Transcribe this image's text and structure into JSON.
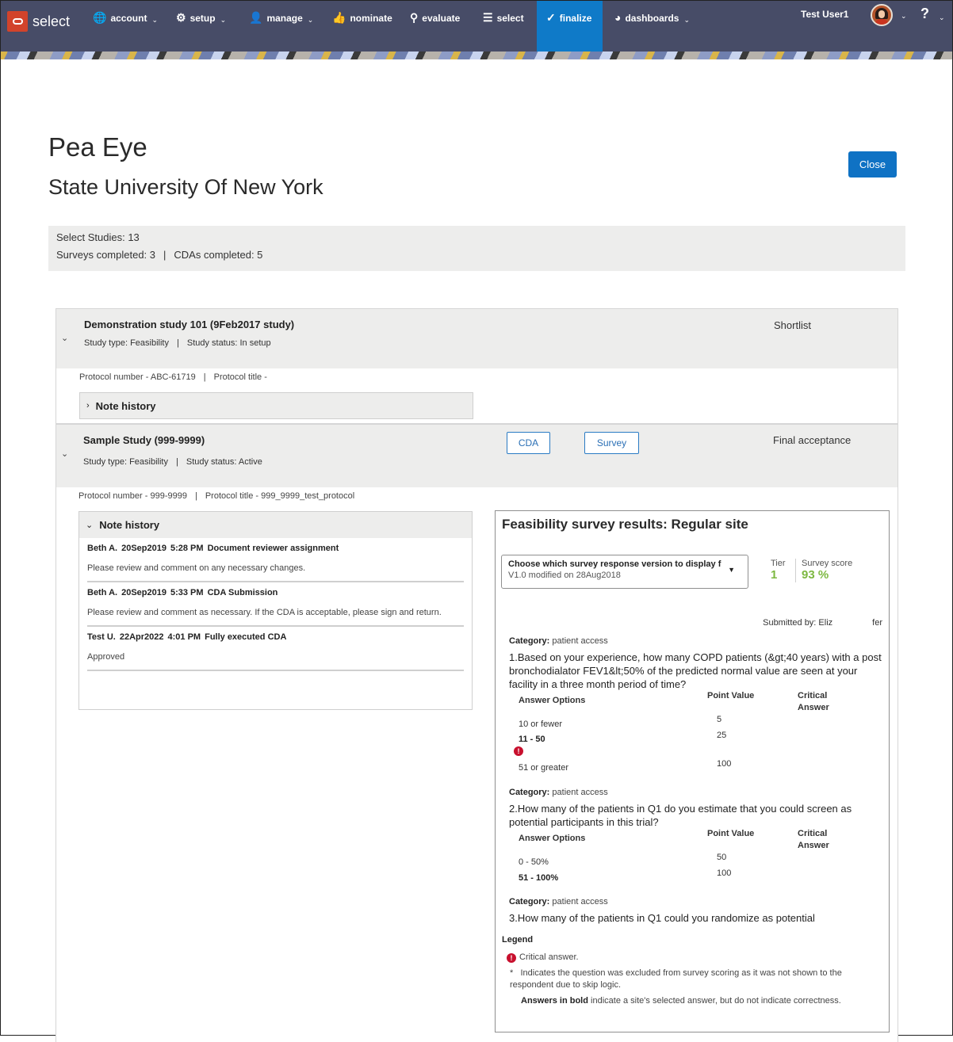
{
  "nav": {
    "brand": "select",
    "items": [
      {
        "label": "account",
        "icon": "globe-icon",
        "has_menu": true
      },
      {
        "label": "setup",
        "icon": "gear-icon",
        "has_menu": true
      },
      {
        "label": "manage",
        "icon": "user-icon",
        "has_menu": true
      },
      {
        "label": "nominate",
        "icon": "thumbs-up-icon",
        "has_menu": false
      },
      {
        "label": "evaluate",
        "icon": "search-icon",
        "has_menu": false
      },
      {
        "label": "select",
        "icon": "list-icon",
        "has_menu": false
      },
      {
        "label": "finalize",
        "icon": "check-circle-icon",
        "has_menu": false,
        "active": true
      },
      {
        "label": "dashboards",
        "icon": "pie-chart-icon",
        "has_menu": true
      }
    ],
    "user_name": "Test User1",
    "help_label": "?",
    "active_color": "#0f7ac8",
    "bar_color": "#474c67"
  },
  "page": {
    "title": "Pea Eye",
    "subtitle": "State University Of New York",
    "close_label": "Close",
    "summary": {
      "select_studies": "Select Studies: 13",
      "surveys_completed": "Surveys completed: 3",
      "separator": "|",
      "cdas_completed": "CDAs completed: 5"
    }
  },
  "studies": [
    {
      "name": "Demonstration study 101 (9Feb2017 study)",
      "type": "Study type: Feasibility",
      "separator": "|",
      "status": "Study status: In setup",
      "stage": "Shortlist",
      "protocol_number": "Protocol number - ABC-61719",
      "protocol_title": "Protocol title -",
      "note_history_label": "Note history",
      "note_history_expanded": false
    },
    {
      "name": "Sample Study (999-9999)",
      "type": "Study type: Feasibility",
      "separator": "|",
      "status": "Study status: Active",
      "stage": "Final acceptance",
      "cda_label": "CDA",
      "survey_label": "Survey",
      "protocol_number": "Protocol number - 999-9999",
      "protocol_title": "Protocol title - 999_9999_test_protocol",
      "note_history_label": "Note history",
      "note_history_expanded": true,
      "notes": [
        {
          "author": "Beth A.",
          "date": "20Sep2019",
          "time": "5:28 PM",
          "subject": "Document reviewer assignment",
          "body": "Please review and comment on any necessary changes."
        },
        {
          "author": "Beth A.",
          "date": "20Sep2019",
          "time": "5:33 PM",
          "subject": "CDA Submission",
          "body": "Please review and comment as necessary. If the CDA is acceptable, please sign and return."
        },
        {
          "author": "Test U.",
          "date": "22Apr2022",
          "time": "4:01 PM",
          "subject": "Fully executed CDA",
          "body": "Approved"
        }
      ]
    }
  ],
  "survey": {
    "title": "Feasibility survey results: Regular site",
    "version_select_label": "Choose which survey response version to display f",
    "version_select_value": "V1.0 modified on 28Aug2018",
    "tier_label": "Tier",
    "tier_value": "1",
    "score_label": "Survey score",
    "score_value": "93 %",
    "score_color": "#7db841",
    "submitted_by_prefix": "Submitted by: Eliz",
    "submitted_by_suffix": "fer",
    "columns": {
      "options": "Answer Options",
      "points": "Point Value",
      "critical_1": "Critical",
      "critical_2": "Answer"
    },
    "category_label": "Category:",
    "questions": [
      {
        "category": "patient access",
        "text": "1.Based on your experience, how many COPD patients (&gt;40 years) with a post bronchodialator FEV1&lt;50% of the predicted normal value are seen at your facility in a three month period of time?",
        "answers": [
          {
            "option": "10 or fewer",
            "points": "5",
            "selected": false,
            "critical": false
          },
          {
            "option": "11 - 50",
            "points": "25",
            "selected": true,
            "critical": true
          },
          {
            "option": "51 or greater",
            "points": "100",
            "selected": false,
            "critical": false
          }
        ]
      },
      {
        "category": "patient access",
        "text": "2.How many of the patients in Q1 do you estimate that you could screen as potential participants in this trial?",
        "answers": [
          {
            "option": "0 - 50%",
            "points": "50",
            "selected": false,
            "critical": false
          },
          {
            "option": "51 - 100%",
            "points": "100",
            "selected": true,
            "critical": false
          }
        ]
      },
      {
        "category": "patient access",
        "text": "3.How many of the patients in Q1 could you randomize as potential"
      }
    ],
    "legend": {
      "title": "Legend",
      "critical": "Critical answer.",
      "asterisk": "*",
      "excluded": "Indicates the question was excluded from survey scoring as it was not shown to the respondent due to skip logic.",
      "bold_prefix": "Answers in bold",
      "bold_suffix": "indicate a site's selected answer, but do not indicate correctness."
    }
  }
}
